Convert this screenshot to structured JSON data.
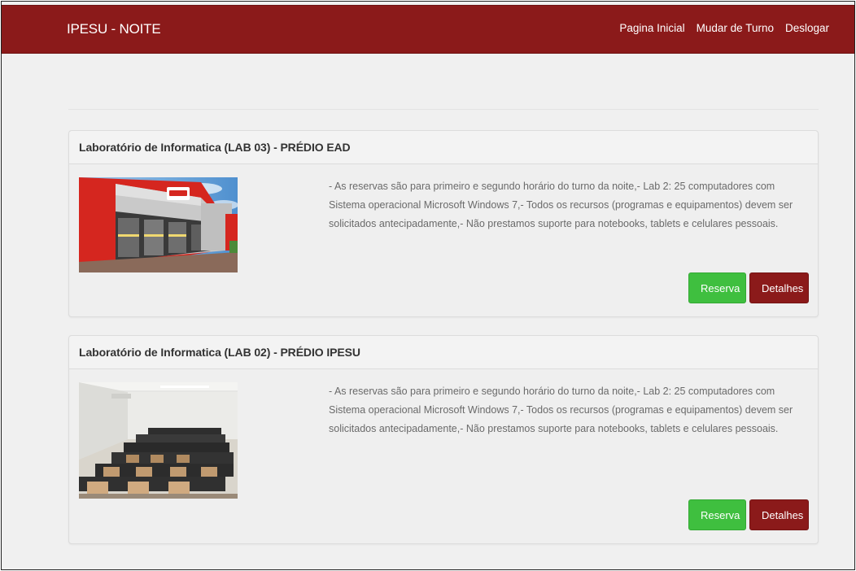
{
  "navbar": {
    "brand": "IPESU - NOITE",
    "links": [
      "Pagina Inicial",
      "Mudar de Turno",
      "Deslogar"
    ]
  },
  "labs": [
    {
      "title": "Laboratório de Informatica (LAB 03) - PRÉDIO EAD",
      "description": "- As reservas são para primeiro e segundo horário do turno da noite,- Lab 2: 25 computadores com Sistema operacional Microsoft Windows 7,- Todos os recursos (programas e equipamentos) devem ser solicitados antecipadamente,- Não prestamos suporte para notebooks, tablets e celulares pessoais.",
      "reserve_label": "Reserva",
      "details_label": "Detalhes"
    },
    {
      "title": "Laboratório de Informatica (LAB 02) - PRÉDIO IPESU",
      "description": "- As reservas são para primeiro e segundo horário do turno da noite,- Lab 2: 25 computadores com Sistema operacional Microsoft Windows 7,- Todos os recursos (programas e equipamentos) devem ser solicitados antecipadamente,- Não prestamos suporte para notebooks, tablets e celulares pessoais.",
      "reserve_label": "Reserva",
      "details_label": "Detalhes"
    }
  ],
  "colors": {
    "brand": "#8b1a1a",
    "success": "#3fbf3f",
    "background": "#f0f0f0"
  }
}
